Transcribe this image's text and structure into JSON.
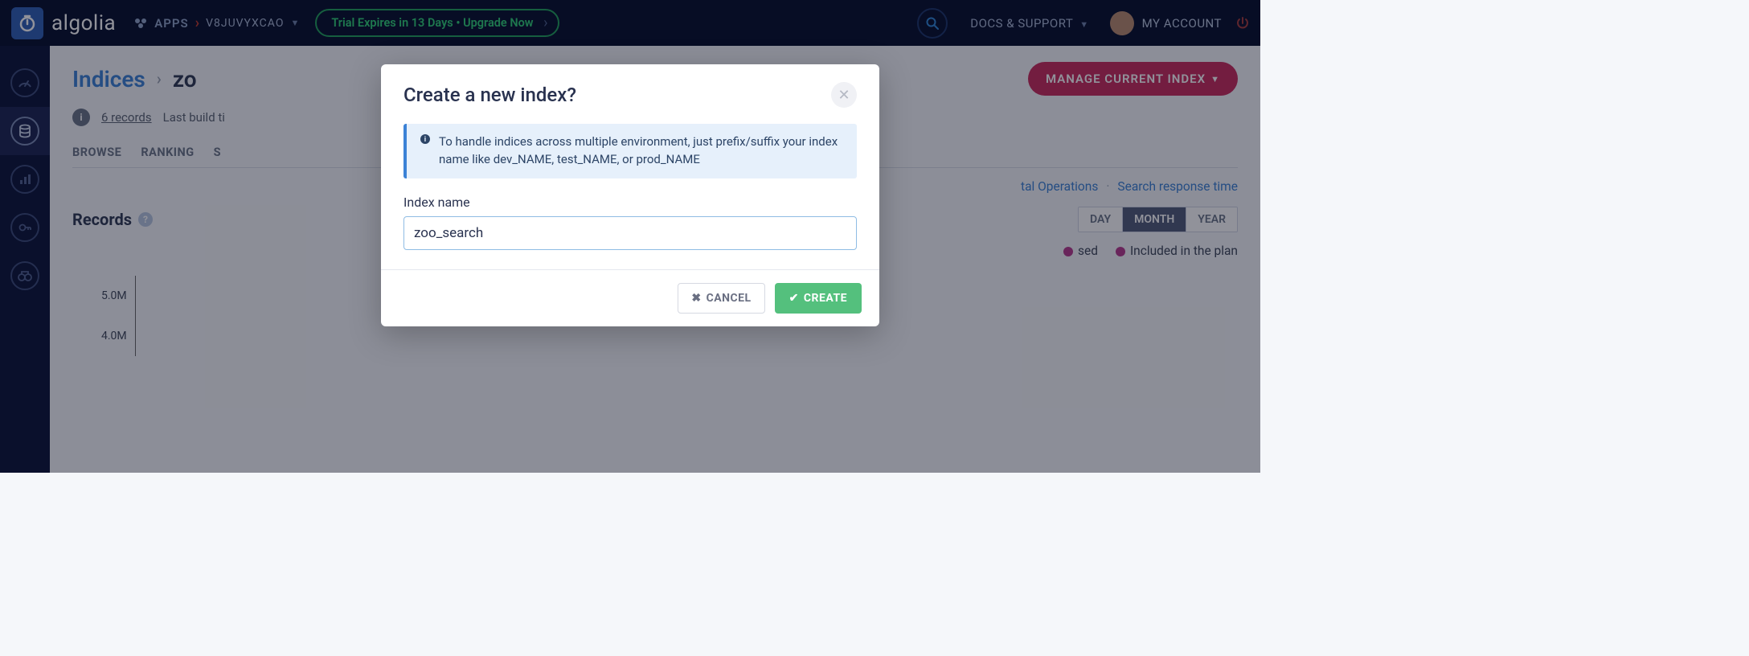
{
  "brand": "algolia",
  "topbar": {
    "apps_label": "APPS",
    "app_id": "V8JUVYXCAO",
    "trial_text": "Trial Expires in 13 Days • Upgrade Now",
    "docs_support": "DOCS & SUPPORT",
    "my_account": "MY ACCOUNT"
  },
  "breadcrumb": {
    "root": "Indices",
    "current": "zo"
  },
  "manage_button": "MANAGE CURRENT INDEX",
  "meta": {
    "records_count": "6 records",
    "last_build_prefix": "Last build ti"
  },
  "tabs": [
    "BROWSE",
    "RANKING",
    "S"
  ],
  "sublinks": {
    "total_ops": "tal Operations",
    "response_time": "Search response time"
  },
  "records_section": {
    "title": "Records",
    "periods": {
      "day": "DAY",
      "month": "MONTH",
      "year": "YEAR"
    }
  },
  "legend": {
    "purchased": "sed",
    "included": "Included in the plan"
  },
  "colors": {
    "purchased_dot": "#b73a8c",
    "included_dot": "#b73a8c"
  },
  "chart_data": {
    "type": "line",
    "title": "Records",
    "ylabel": "",
    "yticks": [
      "5.0M",
      "4.0M"
    ],
    "series": []
  },
  "modal": {
    "title": "Create a new index?",
    "tip": "To handle indices across multiple environment, just prefix/suffix your index name like dev_NAME, test_NAME, or prod_NAME",
    "field_label": "Index name",
    "input_value": "zoo_search",
    "cancel": "CANCEL",
    "create": "CREATE"
  }
}
